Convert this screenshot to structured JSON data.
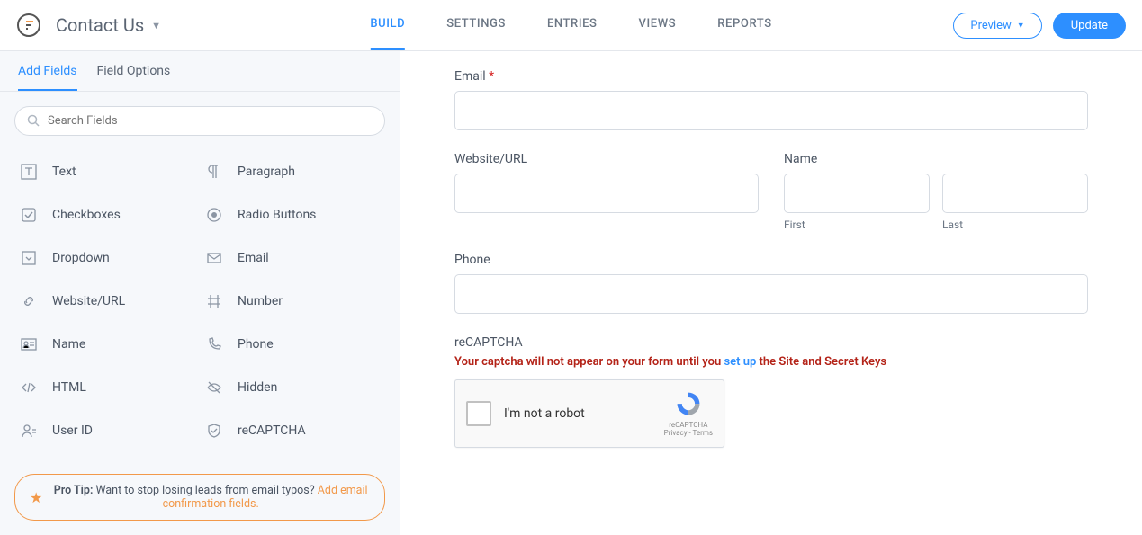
{
  "header": {
    "form_name": "Contact Us",
    "tabs": [
      "BUILD",
      "SETTINGS",
      "ENTRIES",
      "VIEWS",
      "REPORTS"
    ],
    "active_tab": 0,
    "preview_label": "Preview",
    "update_label": "Update"
  },
  "sidebar": {
    "tabs": {
      "add_fields": "Add Fields",
      "field_options": "Field Options"
    },
    "active_tab": "add_fields",
    "search_placeholder": "Search Fields",
    "fields": [
      {
        "icon": "text-icon",
        "label": "Text"
      },
      {
        "icon": "paragraph-icon",
        "label": "Paragraph"
      },
      {
        "icon": "checkbox-icon",
        "label": "Checkboxes"
      },
      {
        "icon": "radio-icon",
        "label": "Radio Buttons"
      },
      {
        "icon": "dropdown-icon",
        "label": "Dropdown"
      },
      {
        "icon": "email-icon",
        "label": "Email"
      },
      {
        "icon": "url-icon",
        "label": "Website/URL"
      },
      {
        "icon": "number-icon",
        "label": "Number"
      },
      {
        "icon": "name-icon",
        "label": "Name"
      },
      {
        "icon": "phone-icon",
        "label": "Phone"
      },
      {
        "icon": "html-icon",
        "label": "HTML"
      },
      {
        "icon": "hidden-icon",
        "label": "Hidden"
      },
      {
        "icon": "userid-icon",
        "label": "User ID"
      },
      {
        "icon": "shield-icon",
        "label": "reCAPTCHA"
      }
    ],
    "pro_tip_prefix": "Pro Tip:",
    "pro_tip_text": "Want to stop losing leads from email typos?",
    "pro_tip_link": "Add email confirmation fields."
  },
  "form": {
    "email": {
      "label": "Email",
      "required": "*"
    },
    "website": {
      "label": "Website/URL"
    },
    "name": {
      "label": "Name",
      "first": "First",
      "last": "Last"
    },
    "phone": {
      "label": "Phone"
    },
    "recaptcha": {
      "label": "reCAPTCHA",
      "warning_pre": "Your captcha will not appear on your form until you ",
      "warning_link": "set up",
      "warning_post": " the Site and Secret Keys",
      "not_robot": "I'm not a robot",
      "brand": "reCAPTCHA",
      "terms": "Privacy - Terms"
    }
  }
}
